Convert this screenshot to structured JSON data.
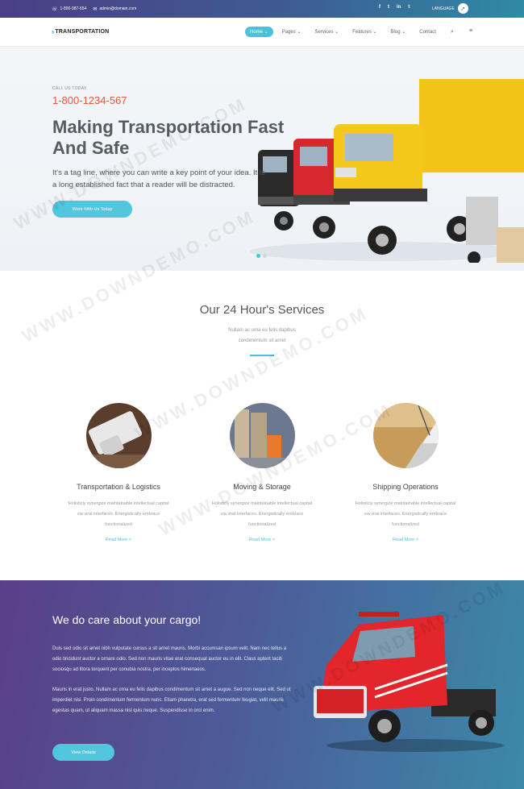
{
  "topbar": {
    "phone": "1-800-987-654",
    "email": "admin@domain.com",
    "social": [
      "f",
      "t",
      "in",
      "t"
    ],
    "language_label": "LANGUAGE"
  },
  "nav": {
    "logo": "TRANSPORTATION",
    "items": [
      {
        "label": "Home",
        "active": true
      },
      {
        "label": "Pages"
      },
      {
        "label": "Services"
      },
      {
        "label": "Features"
      },
      {
        "label": "Blog"
      },
      {
        "label": "Contact"
      }
    ]
  },
  "hero": {
    "call_label": "CALL US TODAY",
    "phone": "1-800-1234-567",
    "headline_line1": "Making Transportation Fast",
    "headline_line2": "And Safe",
    "tagline": "It's a tag line, where you can write a key point of your idea. It is a long established fact that a reader will be distracted.",
    "cta": "Work With Us Today"
  },
  "services": {
    "title": "Our 24 Hour's Services",
    "subtitle": "Nullam ac urna eu felis dapibus condimentum sit amet",
    "items": [
      {
        "title": "Transportation & Logistics",
        "desc": "Holisticly synergize maintainable intellectual capital via viral interfaces. Energistically embrace functionalized",
        "more": "Read More >"
      },
      {
        "title": "Moving & Storage",
        "desc": "Holisticly synergize maintainable intellectual capital via viral interfaces. Energistically embrace functionalized",
        "more": "Read More >"
      },
      {
        "title": "Shipping Operations",
        "desc": "Holisticly synergize maintainable intellectual capital via viral interfaces. Energistically embrace functionalized",
        "more": "Read More >"
      }
    ]
  },
  "cargo": {
    "heading": "We do care about your cargo!",
    "para1": "Duis sed odio sit amet nibh vulputate cursus a sit amet mauris. Morbi accumsan ipsum velit. Nam nec tellus a odio tincidunt auctor a ornare odio. Sed non mauris vitae erat consequat auctor eu in elit. Class aptent taciti sociosqu ad litora torquent per conubia nostra, per inceptos himenaeos.",
    "para2": "Mauris in erat justo. Nullam ac urna eu felis dapibus condimentum sit amet a augue. Sed non neque elit. Sed ut imperdiet nisi. Proin condimentum fermentum nunc. Etiam pharetra, erat sed fermentum feugiat, velit mauris egestas quam, ut aliquam massa nisl quis neque. Suspendisse in orci enim.",
    "button": "View Details"
  },
  "watermark": "WWW.DOWNDEMO.COM",
  "colors": {
    "accent": "#4ac3d9",
    "phone": "#e05a3a"
  }
}
